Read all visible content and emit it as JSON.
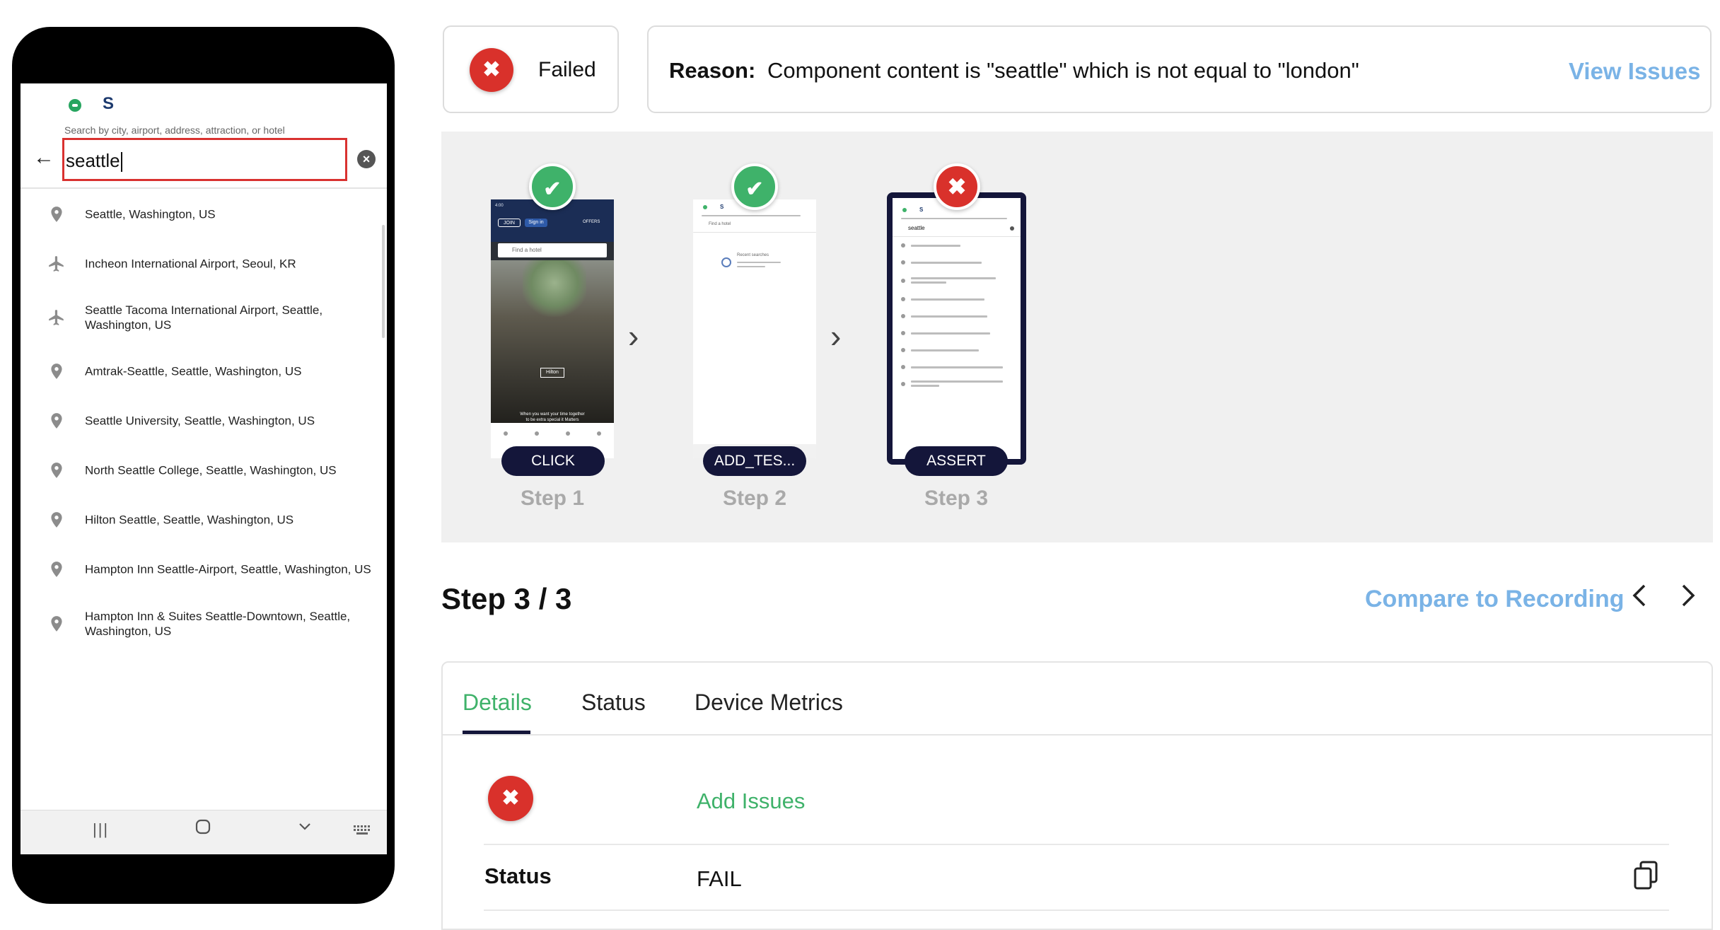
{
  "device": {
    "brand_initial": "S",
    "search_hint": "Search by city, airport, address, attraction, or hotel",
    "search_value": "seattle",
    "results": [
      {
        "icon": "location-pin-icon",
        "label": "Seattle, Washington, US"
      },
      {
        "icon": "airplane-icon",
        "label": "Incheon International Airport, Seoul, KR"
      },
      {
        "icon": "airplane-icon",
        "label": "Seattle Tacoma International Airport, Seattle, Washington, US"
      },
      {
        "icon": "location-pin-icon",
        "label": "Amtrak-Seattle, Seattle, Washington, US"
      },
      {
        "icon": "location-pin-icon",
        "label": "Seattle University, Seattle, Washington, US"
      },
      {
        "icon": "location-pin-icon",
        "label": "North Seattle College, Seattle, Washington, US"
      },
      {
        "icon": "location-pin-icon",
        "label": "Hilton Seattle, Seattle, Washington, US"
      },
      {
        "icon": "location-pin-icon",
        "label": "Hampton Inn Seattle-Airport, Seattle, Washington, US"
      },
      {
        "icon": "location-pin-icon",
        "label": "Hampton Inn & Suites Seattle-Downtown, Seattle, Washington, US"
      }
    ]
  },
  "result": {
    "status_label": "Failed",
    "reason_label": "Reason:",
    "reason_text": "Component content is \"seattle\" which is not equal to \"london\"",
    "view_issues": "View Issues"
  },
  "steps": [
    {
      "label": "Step 1",
      "action": "CLICK",
      "state": "passed"
    },
    {
      "label": "Step 2",
      "action": "ADD_TES...",
      "state": "passed"
    },
    {
      "label": "Step 3",
      "action": "ASSERT",
      "state": "failed"
    }
  ],
  "step_thumbs": {
    "step1": {
      "top_left": "JOIN",
      "top_mid": "Sign in",
      "top_right": "OFFERS",
      "search": "Find a hotel",
      "caption": "When you want your time together to be extra special it Matters Where You Stay.",
      "logo": "Hilton"
    },
    "step2": {
      "search": "Find a hotel",
      "recent": "Recent searches"
    },
    "step3": {
      "search": "seattle"
    }
  },
  "detail": {
    "step_title": "Step 3 / 3",
    "compare": "Compare to Recording",
    "tabs": [
      "Details",
      "Status",
      "Device Metrics"
    ],
    "add_issues": "Add Issues",
    "status_key": "Status",
    "status_value": "FAIL"
  },
  "colors": {
    "fail_red": "#d9312b",
    "pass_green": "#3fb26a",
    "link_blue": "#7ab3e6",
    "navy": "#14163a"
  }
}
